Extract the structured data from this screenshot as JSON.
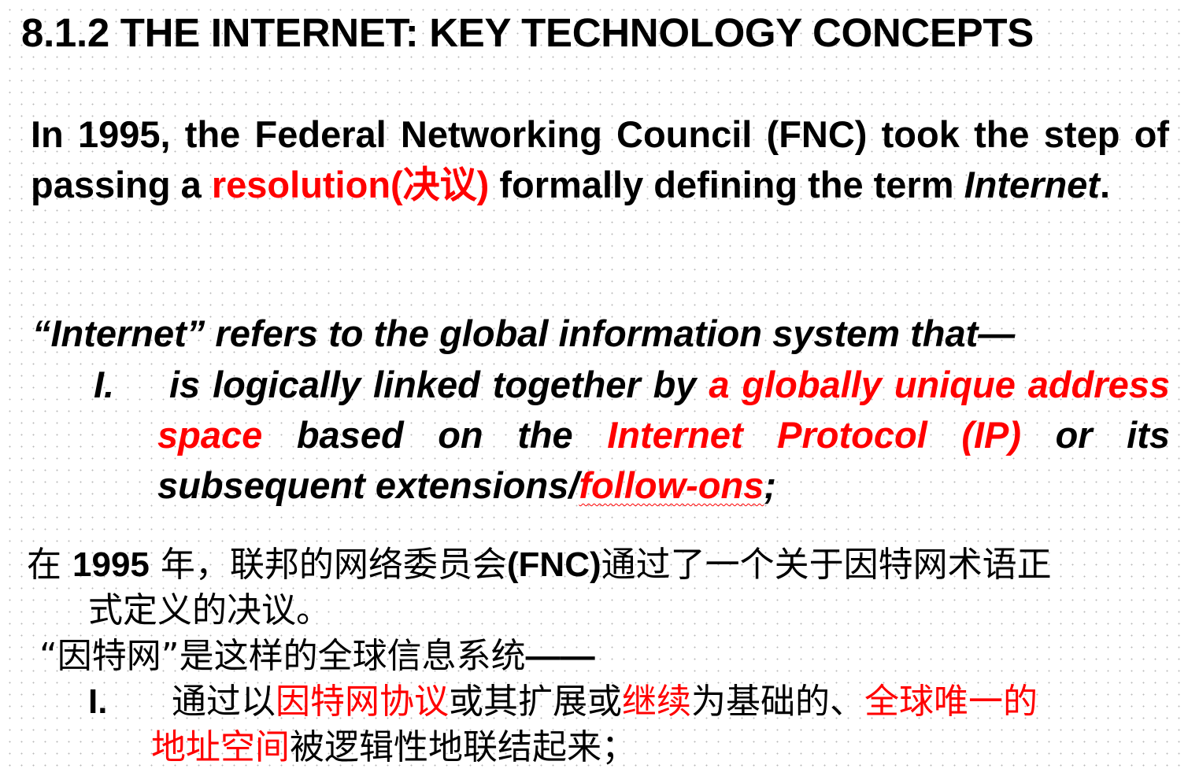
{
  "title": "8.1.2 THE INTERNET: KEY TECHNOLOGY CONCEPTS",
  "intro": {
    "before": "In 1995, the Federal Networking Council (FNC) took the step of passing a ",
    "resolution": "resolution(决议)",
    "middle": " formally defining the term ",
    "term": "Internet",
    "end": "."
  },
  "definition": {
    "lead": "“Internet” refers to the global information system that—",
    "item_marker": "I.",
    "item": {
      "part1": "is logically linked together by ",
      "red1": "a globally unique address space",
      "part2": " based on the ",
      "red2": "Internet Protocol (IP)",
      "part3": " or its subsequent extensions/",
      "red3": "follow-ons",
      "end": ";"
    }
  },
  "chinese": {
    "line1_a": "在 ",
    "line1_year": "1995",
    "line1_b": " 年，联邦的网络委员会",
    "line1_fnc": "(FNC)",
    "line1_c": "通过了一个关于因特网术语正",
    "line2": "式定义的决议。",
    "line3_a": "“因特网”是这样的全球信息系统",
    "line3_dash": "——",
    "item_marker": "I.",
    "item_a": "通过以",
    "item_red1": "因特网协议",
    "item_b": "或其扩展或",
    "item_red2": "继续",
    "item_c": "为基础的、",
    "item_red3": "全球唯一的",
    "item_red4": "地址空间",
    "item_d": "被逻辑性地联结起来；"
  },
  "colors": {
    "accent": "#ff0000",
    "text": "#000000",
    "background": "#ffffff"
  }
}
